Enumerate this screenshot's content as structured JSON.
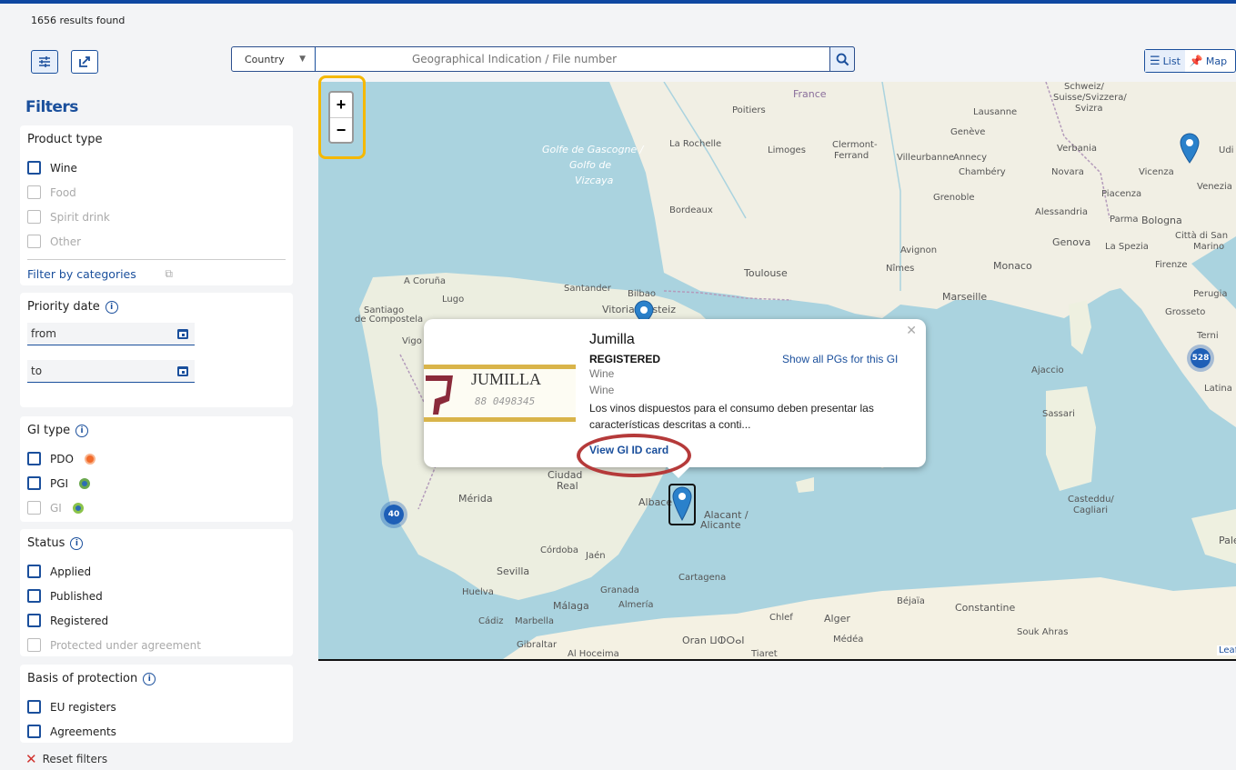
{
  "results_count": "1656 results found",
  "toolbar": {
    "filter_toggle_icon": "sliders-icon",
    "export_icon": "export-icon"
  },
  "search": {
    "country_label": "Country",
    "placeholder": "Geographical Indication / File number"
  },
  "view_toggle": {
    "list_label": "List",
    "map_label": "Map"
  },
  "filters": {
    "title": "Filters",
    "product_type": {
      "title": "Product type",
      "options": [
        "Wine",
        "Food",
        "Spirit drink",
        "Other"
      ],
      "categories_link": "Filter by categories"
    },
    "priority_date": {
      "title": "Priority date",
      "from": "from",
      "to": "to"
    },
    "gi_type": {
      "title": "GI type",
      "options": [
        "PDO",
        "PGI",
        "GI"
      ],
      "colors": [
        "#f26b2b",
        "#2e8b57",
        "#2e6db4"
      ]
    },
    "status": {
      "title": "Status",
      "options": [
        "Applied",
        "Published",
        "Registered",
        "Protected under agreement"
      ]
    },
    "basis": {
      "title": "Basis of protection",
      "options": [
        "EU registers",
        "Agreements"
      ]
    },
    "reset": "Reset filters"
  },
  "map": {
    "labels": {
      "france": "France",
      "schweiz": "Schweiz/",
      "suisse": "Suisse/Svizzera/",
      "svizra": "Svizra",
      "poitiers": "Poitiers",
      "larochelle": "La Rochelle",
      "limoges": "Limoges",
      "clermont": "Clermont-",
      "ferrand": "Ferrand",
      "lausanne": "Lausanne",
      "geneve": "Genève",
      "villeurbanne": "Villeurbanne",
      "annecy": "Annecy",
      "chambery": "Chambéry",
      "grenoble": "Grenoble",
      "verbania": "Verbania",
      "novara": "Novara",
      "vicenza": "Vicenza",
      "venezia": "Venezia",
      "udine": "Udi",
      "piacenza": "Piacenza",
      "alessandria": "Alessandria",
      "parma": "Parma",
      "bologna": "Bologna",
      "genova": "Genova",
      "laspezia": "La Spezia",
      "cittadisan": "Città di San",
      "marino": "Marino",
      "firenze": "Firenze",
      "perugia": "Perugia",
      "grosseto": "Grosseto",
      "terni": "Terni",
      "latina": "Latina",
      "golfe1": "Golfe de Gascogne /",
      "golfe2": "Golfo de",
      "golfe3": "Vizcaya",
      "bordeaux": "Bordeaux",
      "toulouse": "Toulouse",
      "nimes": "Nîmes",
      "avignon": "Avignon",
      "monaco": "Monaco",
      "marseille": "Marseille",
      "acoruna": "A Coruña",
      "santiago": "Santiago",
      "decompostela": "de Compostela",
      "lugo": "Lugo",
      "santander": "Santander",
      "bilbao": "Bilbao",
      "vitoria": "Vitoria-Gasteiz",
      "vigo": "Vigo",
      "ajaccio": "Ajaccio",
      "sassari": "Sassari",
      "casteddu": "Casteddu/",
      "cagliari": "Cagliari",
      "merida": "Mérida",
      "ciudadreal1": "Ciudad",
      "ciudadreal2": "Real",
      "albacete": "Albace",
      "alacant": "Alacant /",
      "alicante": "Alicante",
      "cordoba": "Córdoba",
      "jaen": "Jaén",
      "sevilla": "Sevilla",
      "granada": "Granada",
      "huelva": "Huelva",
      "malaga": "Málaga",
      "cartagena": "Cartagena",
      "cadiz": "Cádiz",
      "marbella": "Marbella",
      "almeria": "Almería",
      "gibraltar": "Gibraltar",
      "alhoceima": "Al Hoceima",
      "oran": "Oran ⵡⵀⵔⴰⵏ",
      "chlef": "Chlef",
      "alger": "Alger",
      "medea": "Médéa",
      "tiaret": "Tiaret",
      "bejaia": "Béjaïa",
      "constantine": "Constantine",
      "soukahras": "Souk Ahras",
      "palermo": "Pale",
      "leaflet": "Leaf"
    },
    "clusters": {
      "italy": "528",
      "portugal": "40"
    }
  },
  "popup": {
    "title": "Jumilla",
    "status": "REGISTERED",
    "line1": "Wine",
    "line2": "Wine",
    "description": "Los vinos dispuestos para el consumo deben presentar las características descritas a conti...",
    "show_all": "Show all PGs for this GI",
    "view_card": "View GI ID card",
    "label_brand": "JUMILLA",
    "label_number": "88 0498345"
  },
  "colors": {
    "brand": "#1a4f9c",
    "highlight": "#f5b800",
    "annotation": "#b53a3a"
  }
}
